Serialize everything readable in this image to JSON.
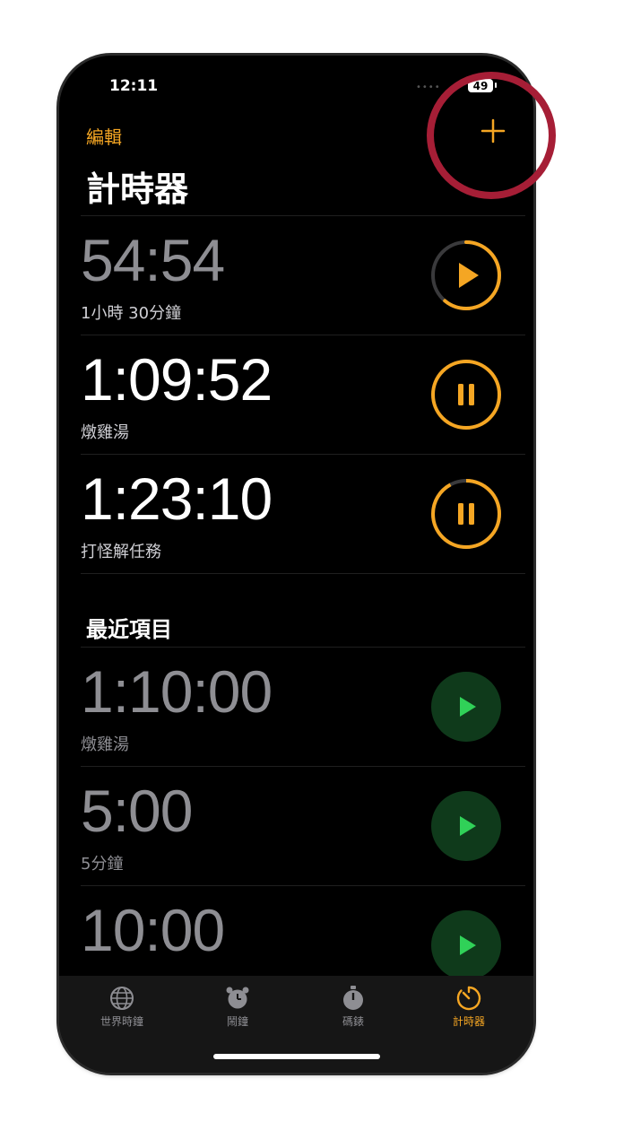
{
  "status": {
    "time": "12:11",
    "battery": "49"
  },
  "header": {
    "edit": "編輯",
    "title": "計時器"
  },
  "active_timers": [
    {
      "time": "54:54",
      "label": "1小時 30分鐘",
      "state": "paused",
      "progress": 0.61
    },
    {
      "time": "1:09:52",
      "label": "燉雞湯",
      "state": "running",
      "progress": 0.99
    },
    {
      "time": "1:23:10",
      "label": "打怪解任務",
      "state": "running",
      "progress": 0.92
    }
  ],
  "recents_title": "最近項目",
  "recent_timers": [
    {
      "time": "1:10:00",
      "label": "燉雞湯"
    },
    {
      "time": "5:00",
      "label": "5分鐘"
    },
    {
      "time": "10:00",
      "label": ""
    }
  ],
  "tabs": [
    {
      "label": "世界時鐘",
      "icon": "globe-icon"
    },
    {
      "label": "鬧鐘",
      "icon": "alarm-clock-icon"
    },
    {
      "label": "碼錶",
      "icon": "stopwatch-icon"
    },
    {
      "label": "計時器",
      "icon": "timer-icon",
      "active": true
    }
  ],
  "colors": {
    "accent": "#f5a623",
    "green": "#30d158",
    "green_bg": "#0f3a1b",
    "highlight": "#a61e36"
  }
}
